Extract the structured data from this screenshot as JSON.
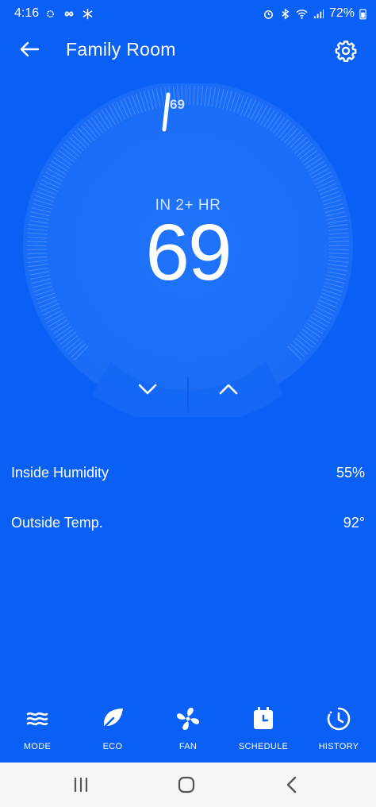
{
  "status_bar": {
    "time": "4:16",
    "battery": "72%"
  },
  "header": {
    "title": "Family Room"
  },
  "thermostat": {
    "target_marker": "69",
    "mode_text": "IN 2+ HR",
    "setpoint": "69"
  },
  "info": {
    "humidity_label": "Inside Humidity",
    "humidity_value": "55%",
    "outside_label": "Outside Temp.",
    "outside_value": "92°"
  },
  "bottom_nav": {
    "items": [
      {
        "label": "MODE",
        "icon": "mode-icon"
      },
      {
        "label": "ECO",
        "icon": "leaf-icon"
      },
      {
        "label": "FAN",
        "icon": "fan-icon"
      },
      {
        "label": "SCHEDULE",
        "icon": "calendar-icon"
      },
      {
        "label": "HISTORY",
        "icon": "history-icon"
      }
    ]
  },
  "colors": {
    "background": "#0a5ff5",
    "dial": "#1b6ef7",
    "text": "#ffffff",
    "system_nav": "#f6f6f6"
  }
}
